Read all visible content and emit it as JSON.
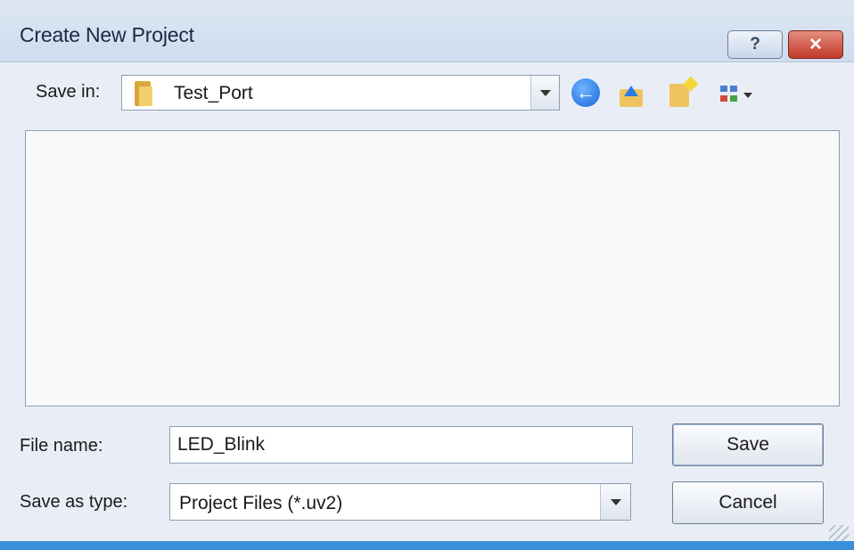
{
  "window": {
    "title": "Create New Project",
    "help_label": "?",
    "close_label": "✕"
  },
  "toolbar": {
    "save_in_label": "Save in:",
    "save_in_value": "Test_Port",
    "back_icon": "back-arrow-icon",
    "up_icon": "up-folder-icon",
    "new_folder_icon": "new-folder-icon",
    "views_icon": "views-menu-icon"
  },
  "file_list": {
    "items": []
  },
  "form": {
    "file_name_label": "File name:",
    "file_name_value": "LED_Blink",
    "save_as_type_label": "Save as type:",
    "save_as_type_value": "Project Files (*.uv2)"
  },
  "buttons": {
    "save_label": "Save",
    "cancel_label": "Cancel"
  },
  "colors": {
    "accent": "#3a8fd8",
    "close": "#c23a27"
  }
}
